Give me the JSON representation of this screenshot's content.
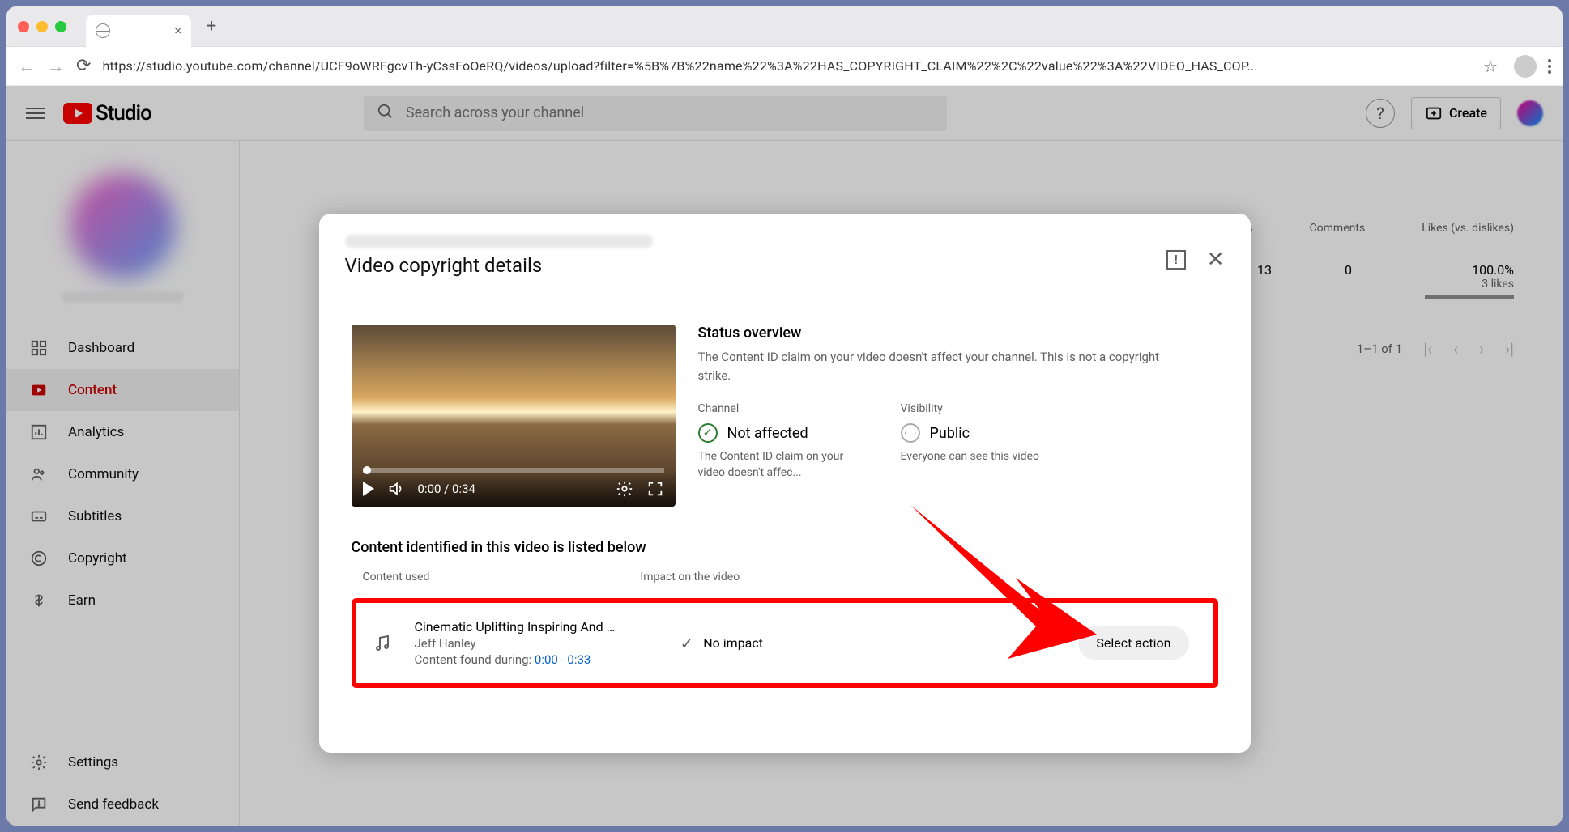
{
  "browser": {
    "url": "https://studio.youtube.com/channel/UCF9oWRFgcvTh-yCssFoOeRQ/videos/upload?filter=%5B%7B%22name%22%3A%22HAS_COPYRIGHT_CLAIM%22%2C%22value%22%3A%22VIDEO_HAS_COP..."
  },
  "header": {
    "logo_text": "Studio",
    "search_placeholder": "Search across your channel",
    "create_label": "Create"
  },
  "sidebar": {
    "items": [
      {
        "label": "Dashboard"
      },
      {
        "label": "Content"
      },
      {
        "label": "Analytics"
      },
      {
        "label": "Community"
      },
      {
        "label": "Subtitles"
      },
      {
        "label": "Copyright"
      },
      {
        "label": "Earn"
      }
    ],
    "bottom": [
      {
        "label": "Settings"
      },
      {
        "label": "Send feedback"
      }
    ]
  },
  "content_cols": {
    "views": "Views",
    "comments": "Comments",
    "likes": "Likes (vs. dislikes)"
  },
  "content_row": {
    "views": "13",
    "comments": "0",
    "likes_pct": "100.0%",
    "likes_sub": "3 likes"
  },
  "pager": {
    "range": "1–1 of 1"
  },
  "modal": {
    "title": "Video copyright details",
    "player_time": "0:00 / 0:34",
    "status_h": "Status overview",
    "status_desc": "The Content ID claim on your video doesn't affect your channel. This is not a copyright strike.",
    "channel": {
      "cat": "Channel",
      "val": "Not affected",
      "sub": "The Content ID claim on your video doesn't affec..."
    },
    "visibility": {
      "cat": "Visibility",
      "val": "Public",
      "sub": "Everyone can see this video"
    },
    "listed_h": "Content identified in this video is listed below",
    "cols": {
      "used": "Content used",
      "impact": "Impact on the video"
    },
    "claim": {
      "title": "Cinematic Uplifting Inspiring And Mot…",
      "artist": "Jeff Hanley",
      "during_label": "Content found during: ",
      "during_range": "0:00 - 0:33",
      "impact": "No impact",
      "action": "Select action"
    }
  }
}
